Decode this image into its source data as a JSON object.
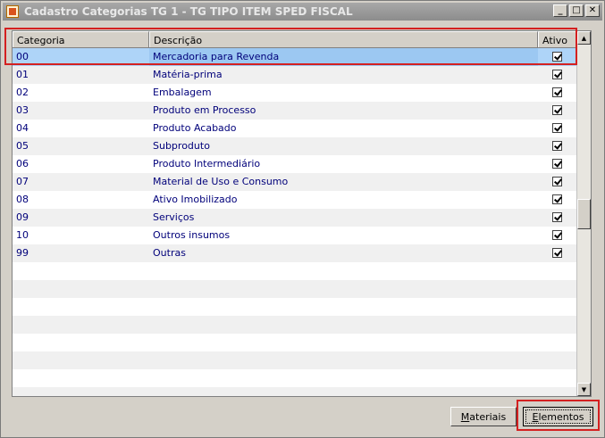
{
  "window": {
    "title": "Cadastro Categorias TG 1 - TG TIPO ITEM SPED FISCAL",
    "controls": {
      "minimize": "_",
      "maximize": "□",
      "close": "✕"
    }
  },
  "grid": {
    "columns": [
      "Categoria",
      "Descrição",
      "Ativo"
    ],
    "rows": [
      {
        "categoria": "00",
        "descricao": "Mercadoria para Revenda",
        "ativo": true
      },
      {
        "categoria": "01",
        "descricao": "Matéria-prima",
        "ativo": true
      },
      {
        "categoria": "02",
        "descricao": "Embalagem",
        "ativo": true
      },
      {
        "categoria": "03",
        "descricao": "Produto em Processo",
        "ativo": true
      },
      {
        "categoria": "04",
        "descricao": "Produto Acabado",
        "ativo": true
      },
      {
        "categoria": "05",
        "descricao": "Subproduto",
        "ativo": true
      },
      {
        "categoria": "06",
        "descricao": "Produto Intermediário",
        "ativo": true
      },
      {
        "categoria": "07",
        "descricao": "Material de Uso e Consumo",
        "ativo": true
      },
      {
        "categoria": "08",
        "descricao": "Ativo Imobilizado",
        "ativo": true
      },
      {
        "categoria": "09",
        "descricao": "Serviços",
        "ativo": true
      },
      {
        "categoria": "10",
        "descricao": "Outros insumos",
        "ativo": true
      },
      {
        "categoria": "99",
        "descricao": "Outras",
        "ativo": true
      }
    ],
    "selected_row": 0,
    "empty_rows": 8
  },
  "buttons": {
    "materiais": {
      "mnemonic": "M",
      "rest": "ateriais"
    },
    "elementos": {
      "mnemonic": "E",
      "rest": "lementos"
    }
  },
  "colors": {
    "selection": "#aed4f8",
    "highlight_box": "#d42020",
    "cell_text": "#00007a"
  }
}
